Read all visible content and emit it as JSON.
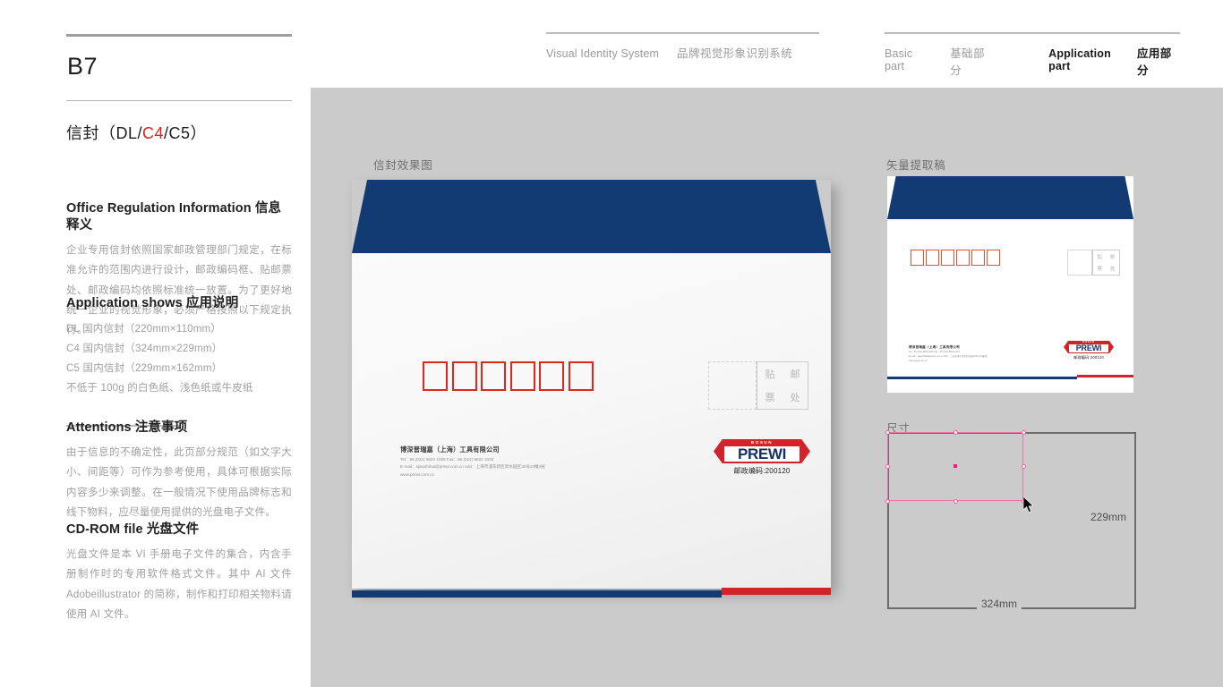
{
  "header": {
    "vis_en": "Visual Identity System",
    "vis_cn": "品牌视觉形象识别系统",
    "basic_en": "Basic part",
    "basic_cn": "基础部分",
    "app_en": "Application part",
    "app_cn": "应用部分"
  },
  "left": {
    "page_code": "B7",
    "title_pre": "信封（DL/",
    "title_hl": "C4",
    "title_post": "/C5）",
    "office": {
      "head_en": "Office Regulation Information ",
      "head_cn": "信息释义",
      "body": "企业专用信封依照国家邮政管理部门规定，在标准允许的范围内进行设计，邮政编码框、贴邮票处、邮政编码均依照标准统一放置。为了更好地统一企业的视觉形象，必须严格按照以下规定执行。"
    },
    "appshow": {
      "head_en": "Application shows ",
      "head_cn": "应用说明",
      "lines": [
        "DL 国内信封（220mm×110mm）",
        "C4 国内信封（324mm×229mm）",
        "C5 国内信封（229mm×162mm）",
        "不低于 100g 的白色纸、浅色纸或牛皮纸"
      ]
    },
    "attentions": {
      "head_en": "Attentions ",
      "head_cn": "注意事项",
      "body": "由于信息的不确定性，此页部分规范（如文字大小、间距等）可作为参考使用，具体可根据实际内容多少来调整。在一般情况下使用品牌标志和线下物料，应尽量使用提供的光盘电子文件。"
    },
    "cdrom": {
      "head_en": "CD-ROM file ",
      "head_cn": "光盘文件",
      "body": "光盘文件是本 VI 手册电子文件的集合，内含手册制作时的专用软件格式文件。其中 AI 文件 Adobeillustrator 的简称，制作和打印相关物料请使用 AI 文件。"
    }
  },
  "stage": {
    "label_mockup": "信封效果图",
    "label_vector": "矢量提取稿",
    "label_size": "尺寸"
  },
  "envelope": {
    "postal_boxes": 6,
    "stamp_chars": [
      "贴",
      "邮",
      "票",
      "处"
    ],
    "corp_name": "博深普瑞嘉（上海）工具有限公司",
    "corp_contact": "Tel：86 (021) 6822 1059    Fax：86 (021) 6822 1033",
    "corp_email": "E-mail：sjiaoshihai@prewi.com.cn    Add：上海市浦东新区新水园区30号10幢3层",
    "corp_web": "www.prewi.com.cn",
    "logo_top": "BOSUN",
    "logo_main": "PREWI",
    "zip_label": "邮政编码:200120"
  },
  "size_diagram": {
    "width_label": "324mm",
    "height_label": "229mm"
  },
  "colors": {
    "navy": "#123a73",
    "red": "#d2232a",
    "postal_red": "#e1261c",
    "stage_gray": "#cbcbcb",
    "accent_pink": "#ec1d7c"
  }
}
